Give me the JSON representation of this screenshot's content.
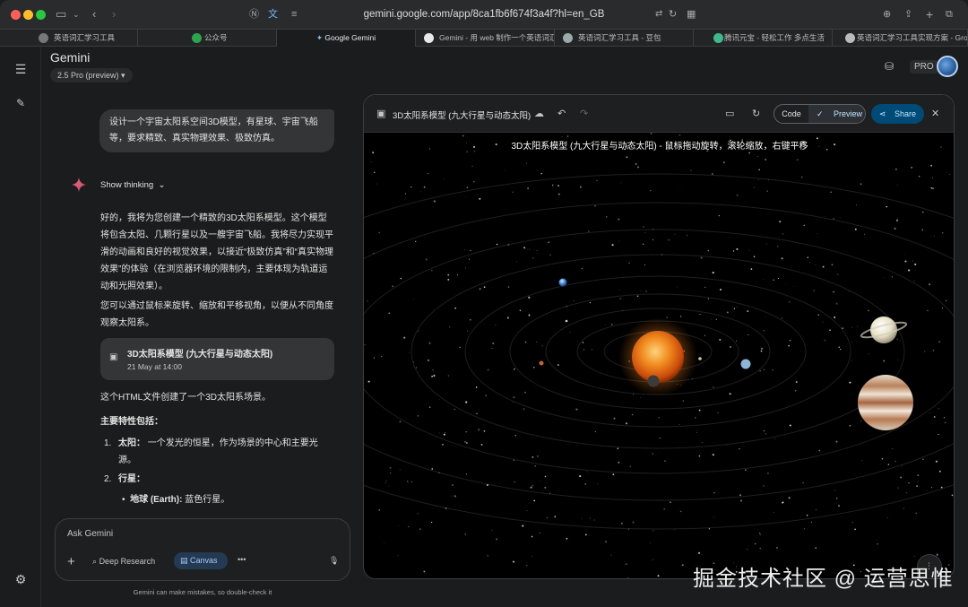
{
  "browser": {
    "url": "gemini.google.com/app/8ca1fb6f674f3a4f?hl=en_GB",
    "tabs": [
      {
        "label": "英语词汇学习工具"
      },
      {
        "label": "公众号"
      },
      {
        "label": "Google Gemini"
      },
      {
        "label": "Gemini - 用 web 制作一个英语词汇..."
      },
      {
        "label": "英语词汇学习工具 - 豆包"
      },
      {
        "label": "腾讯元宝 - 轻松工作 多点生活"
      },
      {
        "label": "英语词汇学习工具实现方案 - Grok"
      }
    ]
  },
  "header": {
    "app_title": "Gemini",
    "model": "2.5 Pro (preview)",
    "pro_badge": "PRO"
  },
  "chat": {
    "user_message": "设计一个宇宙太阳系空间3D模型，有星球、宇宙飞船等，要求精致、真实物理效果、极致仿真。",
    "show_thinking": "Show thinking",
    "reply_p1": "好的，我将为您创建一个精致的3D太阳系模型。这个模型将包含太阳、几颗行星以及一艘宇宙飞船。我将尽力实现平滑的动画和良好的视觉效果，以接近“极致仿真”和“真实物理效果”的体验（在浏览器环境的限制内，主要体现为轨道运动和光照效果）。",
    "reply_p2": "您可以通过鼠标来旋转、缩放和平移视角，以便从不同角度观察太阳系。",
    "card_title": "3D太阳系模型 (九大行星与动态太阳)",
    "card_date": "21 May at 14:00",
    "reply_p3": "这个HTML文件创建了一个3D太阳系场景。",
    "features_heading": "主要特性包括：",
    "item1_num": "1.",
    "item1_bold": "太阳：",
    "item1_text": "一个发光的恒星，作为场景的中心和主要光源。",
    "item2_num": "2.",
    "item2_bold": "行星：",
    "sub1_bold": "地球 (Earth):",
    "sub1_text": "蓝色行星。"
  },
  "input": {
    "placeholder": "Ask Gemini",
    "deep_research": "Deep Research",
    "canvas": "Canvas",
    "disclaimer": "Gemini can make mistakes, so double-check it"
  },
  "panel": {
    "title": "3D太阳系模型 (九大行星与动态太阳)",
    "code_label": "Code",
    "preview_label": "Preview",
    "share_label": "Share",
    "scene_title": "3D太阳系模型 (九大行星与动态太阳) - 鼠标拖动旋转，滚轮缩放，右键平移"
  },
  "watermark": "掘金技术社区 @ 运营思惟"
}
